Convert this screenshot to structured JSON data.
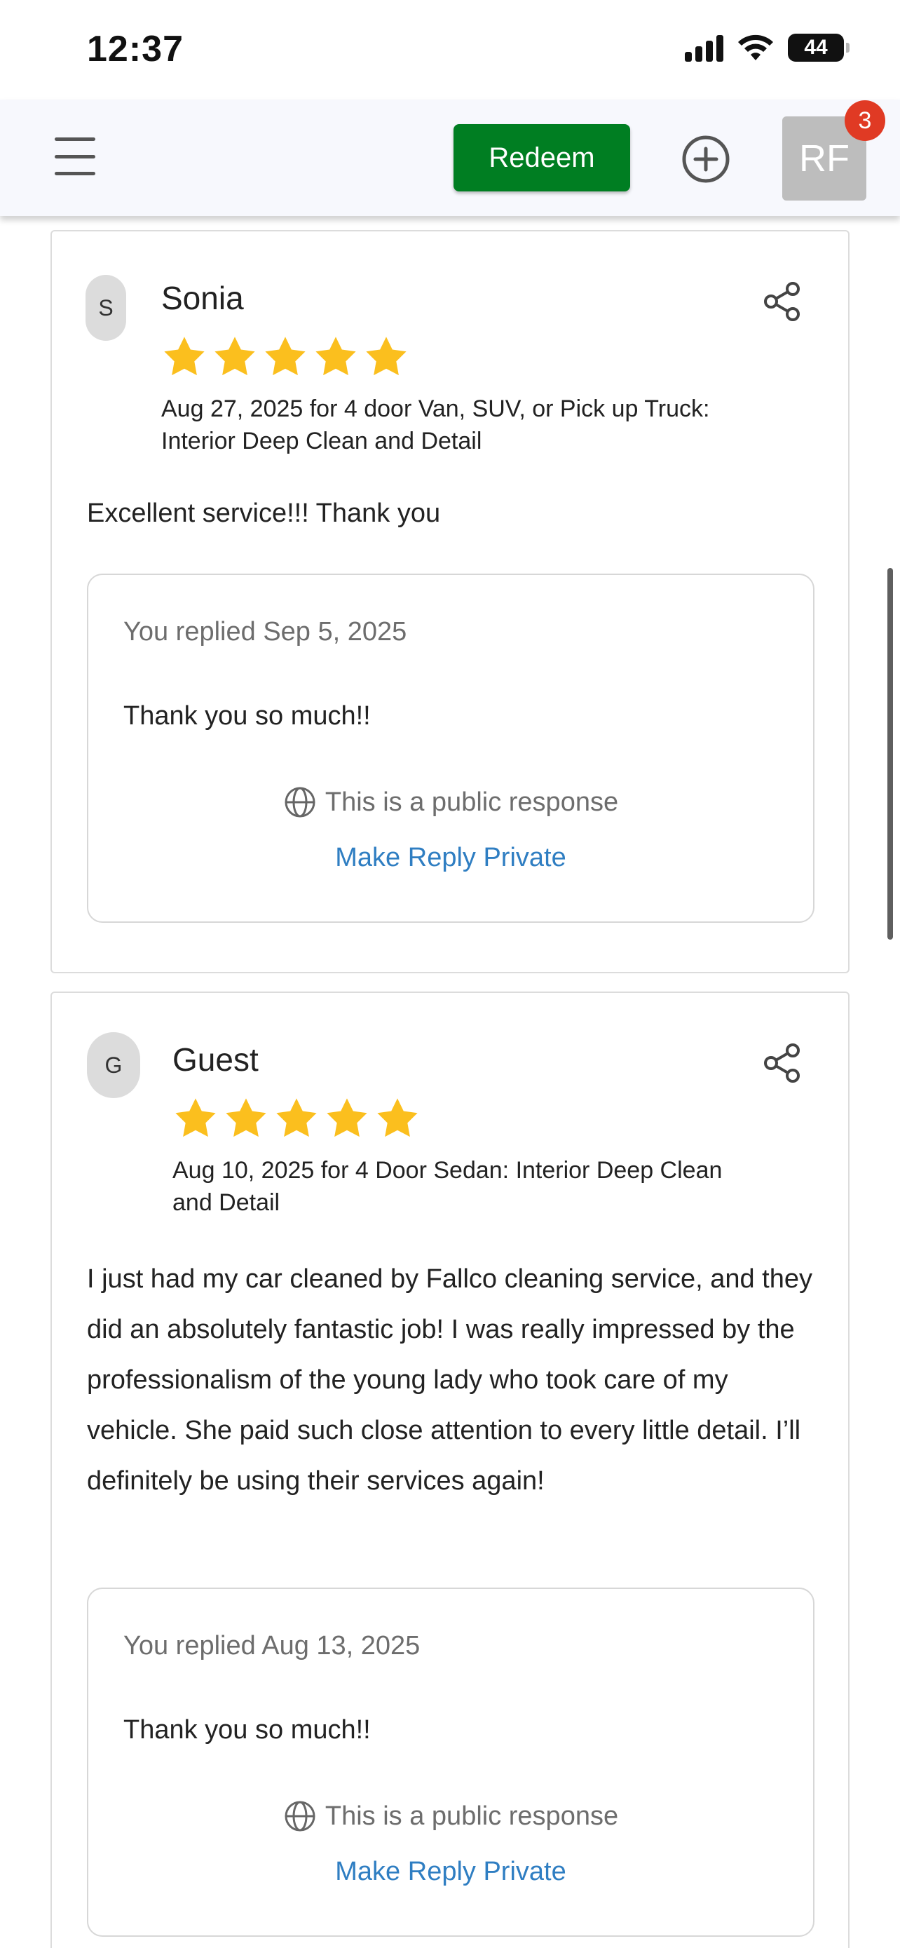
{
  "status_bar": {
    "time": "12:37",
    "battery": "44",
    "icons": [
      "cellular-signal-icon",
      "wifi-icon",
      "battery-icon"
    ]
  },
  "nav": {
    "redeem_label": "Redeem",
    "avatar_initials": "RF",
    "notification_count": "3",
    "icons": [
      "menu-icon",
      "add-circle-icon"
    ]
  },
  "colors": {
    "redeem_green": "#007e22",
    "star_gold": "#fbbf1e",
    "link_blue": "#2f7ec2",
    "badge_red": "#e03a24"
  },
  "reviews": [
    {
      "initial": "S",
      "name": "Sonia",
      "rating": 5,
      "meta": "Aug 27, 2025 for 4 door Van, SUV, or Pick up Truck: Interior Deep Clean and Detail",
      "text": "Excellent service!!! Thank you",
      "reply": {
        "date_label": "You replied Sep 5, 2025",
        "text": "Thank you so much!!",
        "public_label": "This is a public response",
        "action_label": "Make Reply Private"
      }
    },
    {
      "initial": "G",
      "name": "Guest",
      "rating": 5,
      "meta": "Aug 10, 2025 for 4 Door Sedan: Interior Deep Clean and Detail",
      "text": "I just had my car cleaned by Fallco cleaning service, and they did an absolutely fantastic job! I was really impressed by the professionalism of the young lady who took care of my vehicle. She paid such close attention to every little detail. I’ll definitely be using their services again!",
      "reply": {
        "date_label": "You replied Aug 13, 2025",
        "text": "Thank you so much!!",
        "public_label": "This is a public response",
        "action_label": "Make Reply Private"
      }
    }
  ]
}
